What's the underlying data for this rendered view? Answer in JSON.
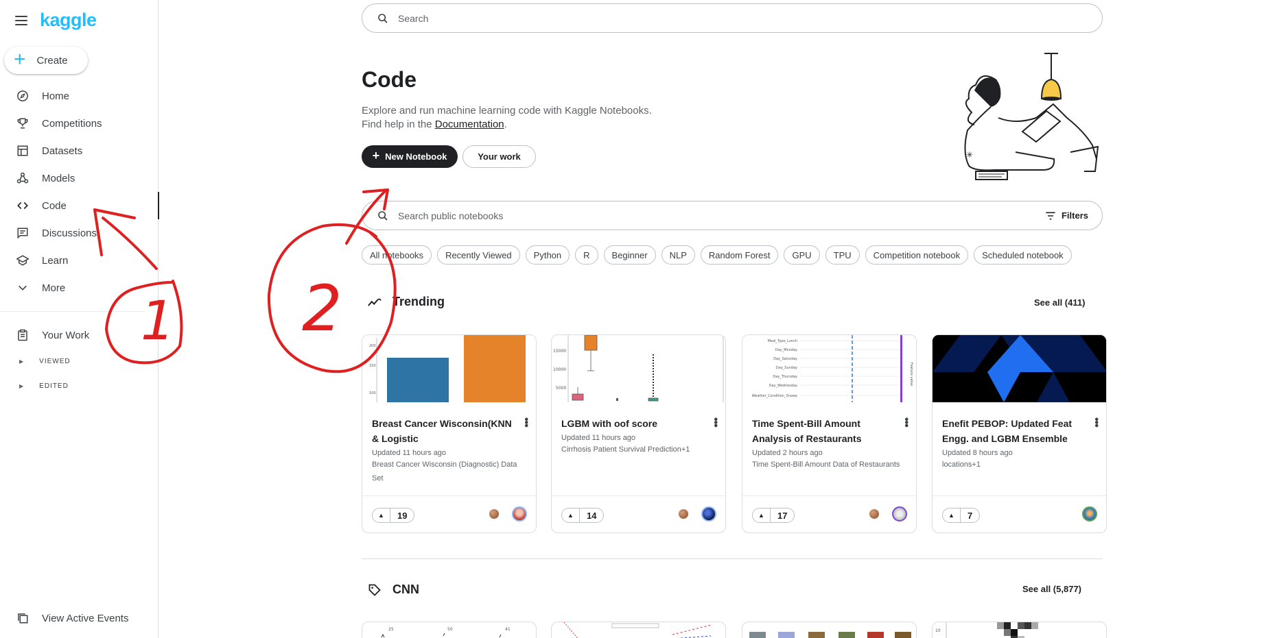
{
  "sidebar": {
    "logo": "kaggle",
    "create_label": "Create",
    "items": [
      {
        "label": "Home",
        "icon": "compass-icon"
      },
      {
        "label": "Competitions",
        "icon": "trophy-icon"
      },
      {
        "label": "Datasets",
        "icon": "table-icon"
      },
      {
        "label": "Models",
        "icon": "models-icon"
      },
      {
        "label": "Code",
        "icon": "code-icon",
        "active": true
      },
      {
        "label": "Discussions",
        "icon": "discussion-icon"
      },
      {
        "label": "Learn",
        "icon": "school-icon"
      },
      {
        "label": "More",
        "icon": "chevron-down-icon"
      }
    ],
    "your_work": "Your Work",
    "sub_items": [
      "VIEWED",
      "EDITED"
    ],
    "view_active_events": "View Active Events"
  },
  "search": {
    "placeholder": "Search"
  },
  "header": {
    "title": "Code",
    "line1": "Explore and run machine learning code with Kaggle Notebooks.",
    "line2_prefix": "Find help in the ",
    "doc_link": "Documentation",
    "line2_suffix": ".",
    "new_notebook": "New Notebook",
    "your_work": "Your work"
  },
  "notebook_search": {
    "placeholder": "Search public notebooks",
    "filters": "Filters"
  },
  "chips": [
    "All notebooks",
    "Recently Viewed",
    "Python",
    "R",
    "Beginner",
    "NLP",
    "Random Forest",
    "GPU",
    "TPU",
    "Competition notebook",
    "Scheduled notebook"
  ],
  "trending": {
    "title": "Trending",
    "see_all": "See all (411)",
    "cards": [
      {
        "title": "Breast Cancer Wisconsin(KNN & Logistic",
        "updated": "Updated 11 hours ago",
        "dataset": "Breast Cancer Wisconsin (Diagnostic) Data Set",
        "votes": "19"
      },
      {
        "title": "LGBM with oof score",
        "updated": "Updated 11 hours ago",
        "dataset": "Cirrhosis Patient Survival Prediction+1",
        "votes": "14"
      },
      {
        "title": "Time Spent-Bill Amount Analysis of Restaurants",
        "updated": "Updated 2 hours ago",
        "dataset": "Time Spent-Bill Amount Data of Restaurants",
        "votes": "17"
      },
      {
        "title": "Enefit PEBOP: Updated Feat Engg. and LGBM Ensemble",
        "updated": "Updated 8 hours ago",
        "dataset": "locations+1",
        "votes": "7"
      }
    ]
  },
  "cnn": {
    "title": "CNN",
    "see_all": "See all (5,877)"
  },
  "thumb_text": {
    "c1_ticks": [
      "200",
      "150",
      "100"
    ],
    "c2_ticks": [
      "15000",
      "10000",
      "5000"
    ],
    "c3_labels": [
      "Meal_Type_Lunch",
      "Day_Monday",
      "Day_Saturday",
      "Day_Sunday",
      "Day_Thursday",
      "Day_Wednesday",
      "Weather_Condition_Snowy"
    ],
    "c3_axis": "Feature value",
    "r2_ticks": [
      "25",
      "50",
      "41",
      "10"
    ]
  },
  "annotations": [
    "1",
    "2"
  ],
  "colors": {
    "accent": "#20beff",
    "dark": "#202124",
    "annotation": "#e02020"
  }
}
